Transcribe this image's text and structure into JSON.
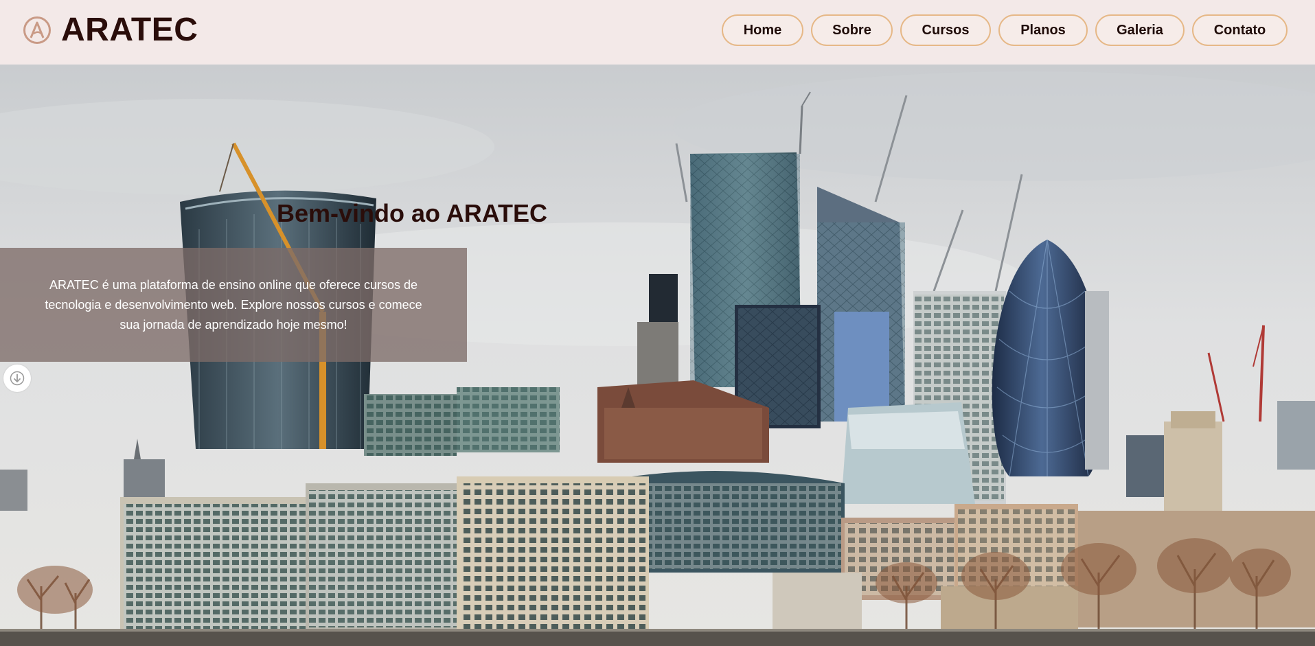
{
  "header": {
    "logo_icon": "aratec-a-logo-icon",
    "brand_name": "ARATEC",
    "nav": [
      "Home",
      "Sobre",
      "Cursos",
      "Planos",
      "Galeria",
      "Contato"
    ]
  },
  "hero": {
    "title": "Bem-vindo ao ARATEC",
    "description": "ARATEC é uma plataforma de ensino online que oferece cursos de tecnologia e desenvolvimento web. Explore nossos cursos e comece sua jornada de aprendizado hoje mesmo!",
    "background": "city-skyline-image",
    "scroll_icon": "arrow-down-icon"
  },
  "colors": {
    "header_bg": "#f3e9e8",
    "brand_text": "#2a0d0a",
    "nav_border": "#e6b887",
    "panel_bg": "rgba(125,108,104,0.78)"
  }
}
